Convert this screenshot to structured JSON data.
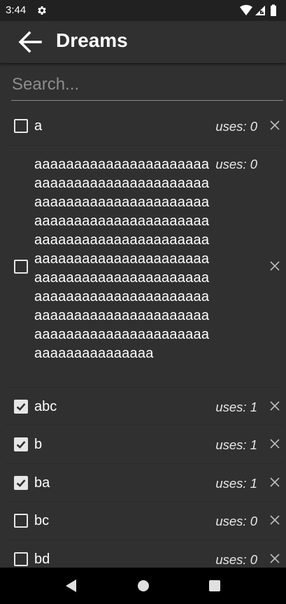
{
  "status_bar": {
    "time": "3:44",
    "icons": [
      "gear-icon",
      "wifi-icon",
      "signal-icon",
      "battery-icon"
    ]
  },
  "app_bar": {
    "title": "Dreams",
    "back_icon": "arrow-back-icon"
  },
  "search": {
    "placeholder": "Search...",
    "value": ""
  },
  "list": {
    "items": [
      {
        "label": "a",
        "checked": false,
        "uses": "uses: 0"
      },
      {
        "label": "aaaaaaaaaaaaaaaaaaaaaaaaaaaaaaaaaaaaaaaaaaaaaaaaaaaaaaaaaaaaaaaaaaaaaaaaaaaaaaaaaaaaaaaaaaaaaaaaaaaaaaaaaaaaaaaaaaaaaaaaaaaaaaaaaaaaaaaaaaaaaaaaaaaaaaaaaaaaaaaaaaaaaaaaaaaaaaaaaaaaaaaaaaaaaaaaaaaaaaaaaaaaaaaaaaaaaaaaaaaaaaaaaaaaaaaaaaa",
        "checked": false,
        "uses": "uses: 0"
      },
      {
        "label": "abc",
        "checked": true,
        "uses": "uses: 1"
      },
      {
        "label": "b",
        "checked": true,
        "uses": "uses: 1"
      },
      {
        "label": "ba",
        "checked": true,
        "uses": "uses: 1"
      },
      {
        "label": "bc",
        "checked": false,
        "uses": "uses: 0"
      },
      {
        "label": "bd",
        "checked": false,
        "uses": "uses: 0"
      }
    ],
    "delete_icon": "close-icon"
  },
  "nav_bar": {
    "icons": [
      "nav-back-icon",
      "nav-home-icon",
      "nav-recents-icon"
    ]
  },
  "colors": {
    "background": "#303030",
    "status_bar": "#212121",
    "nav_bar": "#000000",
    "text": "#ffffff"
  }
}
